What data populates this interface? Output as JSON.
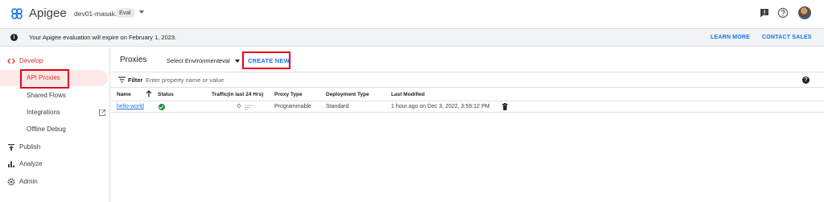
{
  "app": {
    "brand": "Apigee",
    "org": "dev01-masaki",
    "badge": "Eval",
    "icons": [
      "apigee-logo-icon",
      "feedback-icon",
      "help-icon",
      "avatar"
    ]
  },
  "banner": {
    "message": "Your Apigee evaluation will expire on February 1, 2023.",
    "learn_more": "LEARN MORE",
    "contact_sales": "CONTACT SALES"
  },
  "sidebar": {
    "items": [
      {
        "label": "Develop",
        "icon": "code-icon"
      },
      {
        "label": "API Proxies"
      },
      {
        "label": "Shared Flows"
      },
      {
        "label": "Integrations",
        "icon": "open-in-new-icon"
      },
      {
        "label": "Offline Debug"
      },
      {
        "label": "Publish",
        "icon": "publish-icon"
      },
      {
        "label": "Analyze",
        "icon": "bar-chart-icon"
      },
      {
        "label": "Admin",
        "icon": "settings-icon"
      }
    ]
  },
  "main": {
    "title": "Proxies",
    "env_label": "Select Environment:",
    "env_value": "eval",
    "create_new": "CREATE NEW",
    "filter_label": "Filter",
    "filter_placeholder": "Enter property name or value",
    "columns": [
      "Name",
      "Status",
      "Traffic(in last 24 Hrs)",
      "Proxy Type",
      "Deployment Type",
      "Last Modified"
    ],
    "rows": [
      {
        "name": "hello-world",
        "status": "deployed",
        "traffic": "0",
        "proxy_type": "Programmable",
        "deployment_type": "Standard",
        "last_modified": "1 hour ago on Dec 3, 2022, 3:59:12 PM"
      }
    ]
  },
  "colors": {
    "accent": "#1a73e8",
    "develop_red": "#d93025",
    "highlight_red": "#e5001e",
    "status_green": "#1e8e3e"
  }
}
